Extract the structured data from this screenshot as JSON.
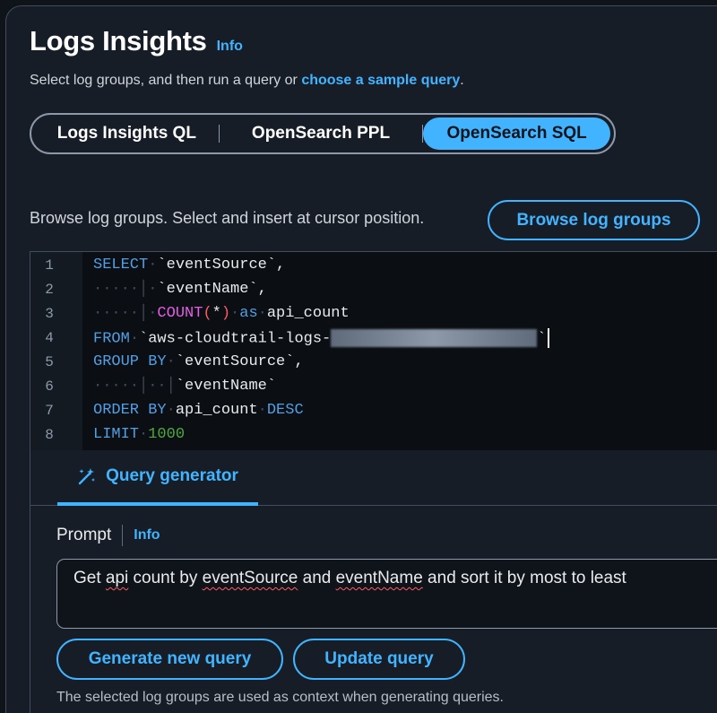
{
  "header": {
    "title": "Logs Insights",
    "info": "Info",
    "subtitle_prefix": "Select log groups, and then run a query or ",
    "subtitle_link": "choose a sample query",
    "subtitle_suffix": "."
  },
  "query_language": {
    "options": [
      "Logs Insights QL",
      "OpenSearch PPL",
      "OpenSearch SQL"
    ],
    "selected": "OpenSearch SQL"
  },
  "browse": {
    "hint": "Browse log groups. Select and insert at cursor position.",
    "button": "Browse log groups"
  },
  "editor": {
    "line_numbers": [
      "1",
      "2",
      "3",
      "4",
      "5",
      "6",
      "7",
      "8"
    ],
    "l1_kw": "SELECT",
    "l1_txt": "`eventSource`,",
    "l2_txt": "`eventName`,",
    "l3_fn": "COUNT",
    "l3_paren_open": "(",
    "l3_star": "*",
    "l3_paren_close": ")",
    "l3_kw": "as",
    "l3_txt": "api_count",
    "l4_kw": "FROM",
    "l4_txt": "`aws-cloudtrail-logs-",
    "l4_end": "`",
    "l5_kw": "GROUP BY",
    "l5_txt": "`eventSource`,",
    "l6_txt": "`eventName`",
    "l7_kw": "ORDER BY",
    "l7_txt": "api_count",
    "l7_kw2": "DESC",
    "l8_kw": "LIMIT",
    "l8_num": "1000"
  },
  "generator": {
    "tab_label": "Query generator",
    "prompt_label": "Prompt",
    "prompt_info": "Info",
    "prompt_parts": {
      "p1": "Get ",
      "p2": "api",
      "p3": " count by ",
      "p4": "eventSource",
      "p5": " and ",
      "p6": "eventName",
      "p7": " and sort it by most to least"
    },
    "generate_button": "Generate new query",
    "update_button": "Update query",
    "footnote": "The selected log groups are used as context when generating queries."
  },
  "icons": {
    "query_generator": "magic-wand-icon"
  },
  "colors": {
    "accent": "#42b4ff",
    "background": "#161d26",
    "editor_bg": "#0b0f14"
  }
}
